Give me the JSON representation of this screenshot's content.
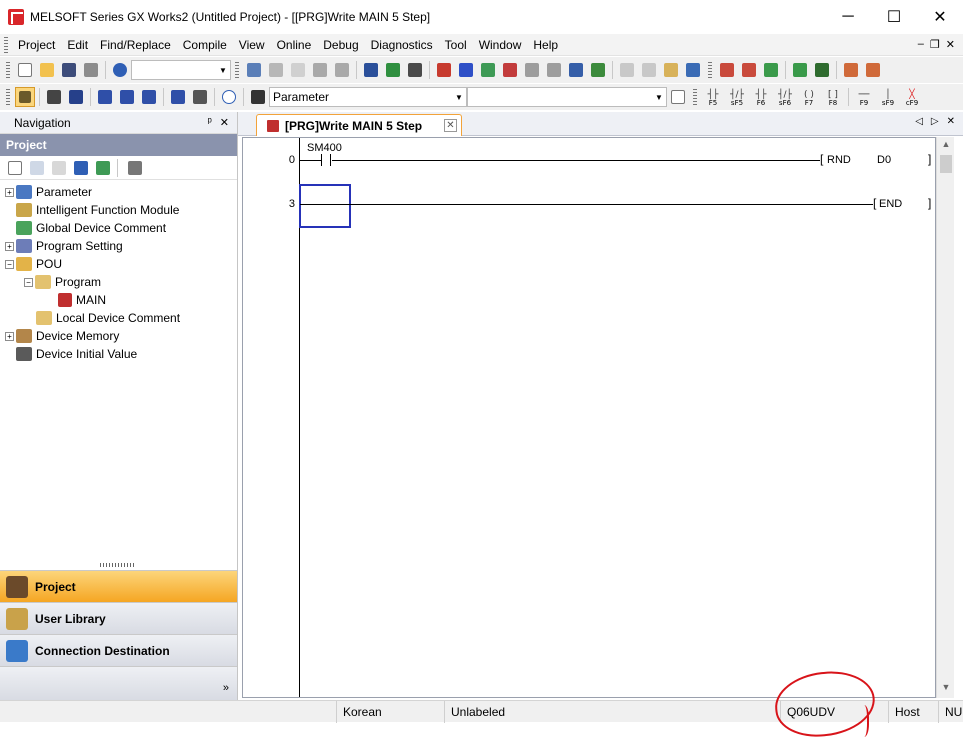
{
  "window": {
    "title": "MELSOFT Series GX Works2 (Untitled Project) - [[PRG]Write MAIN 5 Step]",
    "minimize": "─",
    "maximize": "☐",
    "close": "✕"
  },
  "menu": {
    "items": [
      "Project",
      "Edit",
      "Find/Replace",
      "Compile",
      "View",
      "Online",
      "Debug",
      "Diagnostics",
      "Tool",
      "Window",
      "Help"
    ],
    "mdi_min": "‒",
    "mdi_restore": "❐",
    "mdi_close": "✕"
  },
  "toolbar2": {
    "parameter_combo": "Parameter",
    "fkeys": [
      {
        "sym": "┤├",
        "label": "F5"
      },
      {
        "sym": "┤/├",
        "label": "sF5"
      },
      {
        "sym": "┤├",
        "label": "F6"
      },
      {
        "sym": "┤/├",
        "label": "sF6"
      },
      {
        "sym": "( )",
        "label": "F7"
      },
      {
        "sym": "[ ]",
        "label": "F8"
      },
      {
        "sym": "──",
        "label": "F9"
      },
      {
        "sym": "│",
        "label": "sF9"
      },
      {
        "sym": "╳",
        "label": "cF9"
      }
    ]
  },
  "navigation": {
    "header": "Navigation",
    "pin": "ᵖ",
    "close": "✕",
    "project_title": "Project",
    "tree": [
      {
        "label": "Parameter",
        "level": 0,
        "expander": "+",
        "icon_color": "#4a78c2"
      },
      {
        "label": "Intelligent Function Module",
        "level": 0,
        "expander": "",
        "icon_color": "#c9a64a"
      },
      {
        "label": "Global Device Comment",
        "level": 0,
        "expander": "",
        "icon_color": "#4aa35c"
      },
      {
        "label": "Program Setting",
        "level": 0,
        "expander": "+",
        "icon_color": "#6d7db8"
      },
      {
        "label": "POU",
        "level": 0,
        "expander": "−",
        "icon_color": "#e3b348"
      },
      {
        "label": "Program",
        "level": 1,
        "expander": "−",
        "icon_color": "#e3c26f"
      },
      {
        "label": "MAIN",
        "level": 2,
        "expander": "",
        "icon_color": "#c02f2f"
      },
      {
        "label": "Local Device Comment",
        "level": 1,
        "expander": "",
        "icon_color": "#e3c26f"
      },
      {
        "label": "Device Memory",
        "level": 0,
        "expander": "+",
        "icon_color": "#b3864a"
      },
      {
        "label": "Device Initial Value",
        "level": 0,
        "expander": "",
        "icon_color": "#5a5a5a"
      }
    ],
    "bottom_buttons": [
      {
        "label": "Project",
        "active": true,
        "icon_color": "#6b4a2a"
      },
      {
        "label": "User Library",
        "active": false,
        "icon_color": "#c9a24a"
      },
      {
        "label": "Connection Destination",
        "active": false,
        "icon_color": "#3a7ac9"
      }
    ],
    "more": "»"
  },
  "document": {
    "tab_label": "[PRG]Write MAIN 5 Step",
    "tab_close": "✕",
    "nav_prev": "◁",
    "nav_next": "▷",
    "nav_close": "✕",
    "rungs": [
      {
        "step": "0",
        "contact_device": "SM400",
        "instruction": "RND",
        "operand": "D0"
      },
      {
        "step": "3",
        "instruction": "END"
      }
    ]
  },
  "statusbar": {
    "language": "Korean",
    "label_mode": "Unlabeled",
    "cpu_type": "Q06UDV",
    "connection": "Host",
    "num": "NU"
  },
  "colors": {
    "accent_orange": "#f5a623",
    "nav_title_bg": "#8a93ad",
    "cursor_blue": "#2632b8",
    "annotation_red": "#d8141a"
  }
}
